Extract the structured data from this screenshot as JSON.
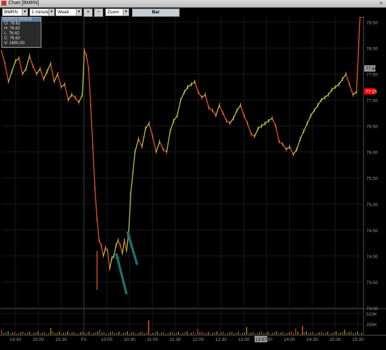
{
  "window": {
    "title": "Chart [BMRN]",
    "close_label": "×"
  },
  "toolbar": {
    "symbol": "BMRN",
    "interval": "1 minute",
    "period": "Week",
    "zoom_in_label": "+",
    "zoom_out_label": "−",
    "zoom_label": "Zoom",
    "style_label": "Bar"
  },
  "ohlc": {
    "header": "01/07/13 13:55:00",
    "rows": [
      "O: 76.62",
      "H: 76.62",
      "L: 76.62",
      "C: 76.62",
      "V: 1600.00"
    ]
  },
  "colors": {
    "up": "#b4c83c",
    "down": "#e8531e",
    "price_tag": "#ff0000",
    "arrow": "#1e6e6e",
    "grid": "#1a1a1a",
    "axis_text": "#9a9a9a"
  },
  "chart_data": {
    "type": "line",
    "title": "",
    "xlabel": "",
    "ylabel": "",
    "ylim": [
      73.0,
      78.6
    ],
    "y_ticks": [
      "73.00",
      "73.50",
      "74.00",
      "74.50",
      "75.00",
      "75.50",
      "76.00",
      "76.50",
      "77.00",
      "77.50",
      "78.00",
      "78.50"
    ],
    "x_ticks": [
      "14:30",
      "15:00",
      "15:30",
      "Fri",
      "10:00",
      "10:30",
      "11:00",
      "11:30",
      "12:00",
      "12:30",
      "13:00",
      "13:30",
      "14:00",
      "14:30",
      "15:00",
      "15:30"
    ],
    "current_price": "77.16",
    "highlighted_price": "77.60",
    "highlighted_time": "13:57",
    "volume_ticks": [
      "510K",
      "255K"
    ],
    "x": [
      0,
      5,
      10,
      15,
      20,
      25,
      30,
      35,
      40,
      45,
      50,
      55,
      60,
      65,
      70,
      75,
      80,
      85,
      90,
      95,
      100,
      105,
      110,
      115,
      118,
      121,
      124,
      127,
      130,
      133,
      136,
      139,
      142,
      145,
      148,
      151,
      154,
      157,
      160,
      163,
      166,
      169,
      172,
      175,
      178,
      181,
      184,
      187,
      190,
      195,
      200,
      205,
      210,
      215,
      220,
      225,
      230,
      235,
      240,
      245,
      250,
      255,
      260,
      265,
      270,
      275,
      280,
      285,
      290,
      295,
      300,
      305,
      310,
      315,
      320,
      325,
      330,
      335,
      340,
      345,
      350,
      355,
      360,
      365,
      370,
      375,
      380,
      385,
      390,
      395,
      400,
      405,
      410,
      415,
      420,
      425,
      430,
      435,
      440,
      445,
      450,
      455,
      460,
      465,
      470,
      475,
      480,
      485,
      490,
      495,
      500,
      505,
      510,
      515
    ],
    "y": [
      77.95,
      77.7,
      77.35,
      77.55,
      77.75,
      77.8,
      77.5,
      77.6,
      77.85,
      77.65,
      77.5,
      77.6,
      77.4,
      77.55,
      77.7,
      77.35,
      77.5,
      77.25,
      77.3,
      77.0,
      77.1,
      77.05,
      76.95,
      77.1,
      77.95,
      77.85,
      77.6,
      76.9,
      76.1,
      75.3,
      74.7,
      74.3,
      74.2,
      74.0,
      74.15,
      74.1,
      73.75,
      73.95,
      74.0,
      74.2,
      74.3,
      74.2,
      74.05,
      74.3,
      74.1,
      74.45,
      75.2,
      75.6,
      76.0,
      76.25,
      76.1,
      76.45,
      76.55,
      76.3,
      76.0,
      76.2,
      76.05,
      76.0,
      76.4,
      76.6,
      76.7,
      77.0,
      77.15,
      77.25,
      77.3,
      77.35,
      77.15,
      77.05,
      77.1,
      76.85,
      76.8,
      76.7,
      76.9,
      76.75,
      76.6,
      76.55,
      76.65,
      76.8,
      76.9,
      76.7,
      76.55,
      76.35,
      76.3,
      76.45,
      76.5,
      76.55,
      76.6,
      76.65,
      76.5,
      76.2,
      76.15,
      76.05,
      76.1,
      75.95,
      76.05,
      76.25,
      76.4,
      76.55,
      76.7,
      76.8,
      76.9,
      77.0,
      77.05,
      77.1,
      77.2,
      77.25,
      77.3,
      77.4,
      77.5,
      77.3,
      77.1,
      77.16
    ]
  }
}
